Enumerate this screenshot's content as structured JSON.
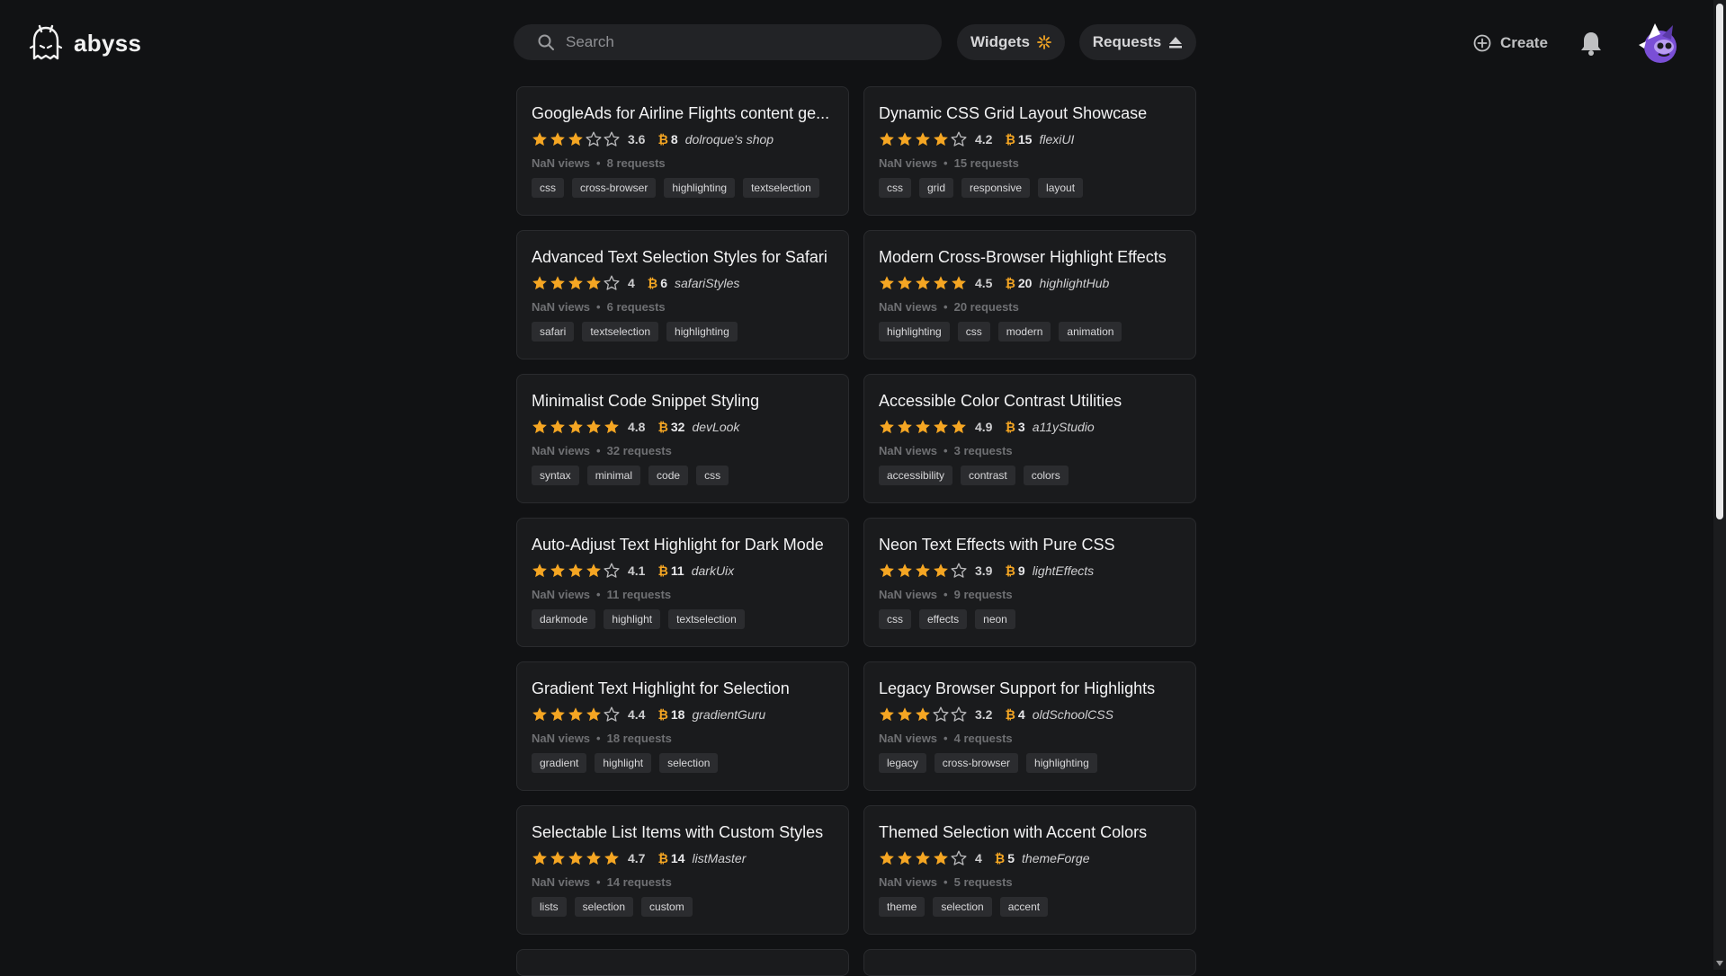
{
  "app": {
    "name": "abyss"
  },
  "header": {
    "search_placeholder": "Search",
    "widgets_label": "Widgets",
    "requests_label": "Requests",
    "create_label": "Create"
  },
  "colors": {
    "accent": "#f5a623",
    "star": "#f5a623",
    "background": "#111214",
    "card": "#1a1b1d"
  },
  "cards": [
    {
      "title": "GoogleAds for Airline Flights content ge...",
      "rating": "3.6",
      "stars": 3.6,
      "bounty": "8",
      "author": "dolroque's shop",
      "views": "NaN views",
      "requests": "8 requests",
      "tags": [
        "css",
        "cross-browser",
        "highlighting",
        "textselection"
      ]
    },
    {
      "title": "Dynamic CSS Grid Layout Showcase",
      "rating": "4.2",
      "stars": 4.2,
      "bounty": "15",
      "author": "flexiUI",
      "views": "NaN views",
      "requests": "15 requests",
      "tags": [
        "css",
        "grid",
        "responsive",
        "layout"
      ]
    },
    {
      "title": "Advanced Text Selection Styles for Safari",
      "rating": "4",
      "stars": 4,
      "bounty": "6",
      "author": "safariStyles",
      "views": "NaN views",
      "requests": "6 requests",
      "tags": [
        "safari",
        "textselection",
        "highlighting"
      ]
    },
    {
      "title": "Modern Cross-Browser Highlight Effects",
      "rating": "4.5",
      "stars": 5,
      "bounty": "20",
      "author": "highlightHub",
      "views": "NaN views",
      "requests": "20 requests",
      "tags": [
        "highlighting",
        "css",
        "modern",
        "animation"
      ]
    },
    {
      "title": "Minimalist Code Snippet Styling",
      "rating": "4.8",
      "stars": 5,
      "bounty": "32",
      "author": "devLook",
      "views": "NaN views",
      "requests": "32 requests",
      "tags": [
        "syntax",
        "minimal",
        "code",
        "css"
      ]
    },
    {
      "title": "Accessible Color Contrast Utilities",
      "rating": "4.9",
      "stars": 5,
      "bounty": "3",
      "author": "a11yStudio",
      "views": "NaN views",
      "requests": "3 requests",
      "tags": [
        "accessibility",
        "contrast",
        "colors"
      ]
    },
    {
      "title": "Auto-Adjust Text Highlight for Dark Mode",
      "rating": "4.1",
      "stars": 4,
      "bounty": "11",
      "author": "darkUix",
      "views": "NaN views",
      "requests": "11 requests",
      "tags": [
        "darkmode",
        "highlight",
        "textselection"
      ]
    },
    {
      "title": "Neon Text Effects with Pure CSS",
      "rating": "3.9",
      "stars": 4,
      "bounty": "9",
      "author": "lightEffects",
      "views": "NaN views",
      "requests": "9 requests",
      "tags": [
        "css",
        "effects",
        "neon"
      ]
    },
    {
      "title": "Gradient Text Highlight for Selection",
      "rating": "4.4",
      "stars": 4,
      "bounty": "18",
      "author": "gradientGuru",
      "views": "NaN views",
      "requests": "18 requests",
      "tags": [
        "gradient",
        "highlight",
        "selection"
      ]
    },
    {
      "title": "Legacy Browser Support for Highlights",
      "rating": "3.2",
      "stars": 3,
      "bounty": "4",
      "author": "oldSchoolCSS",
      "views": "NaN views",
      "requests": "4 requests",
      "tags": [
        "legacy",
        "cross-browser",
        "highlighting"
      ]
    },
    {
      "title": "Selectable List Items with Custom Styles",
      "rating": "4.7",
      "stars": 5,
      "bounty": "14",
      "author": "listMaster",
      "views": "NaN views",
      "requests": "14 requests",
      "tags": [
        "lists",
        "selection",
        "custom"
      ]
    },
    {
      "title": "Themed Selection with Accent Colors",
      "rating": "4",
      "stars": 4,
      "bounty": "5",
      "author": "themeForge",
      "views": "NaN views",
      "requests": "5 requests",
      "tags": [
        "theme",
        "selection",
        "accent"
      ]
    }
  ]
}
